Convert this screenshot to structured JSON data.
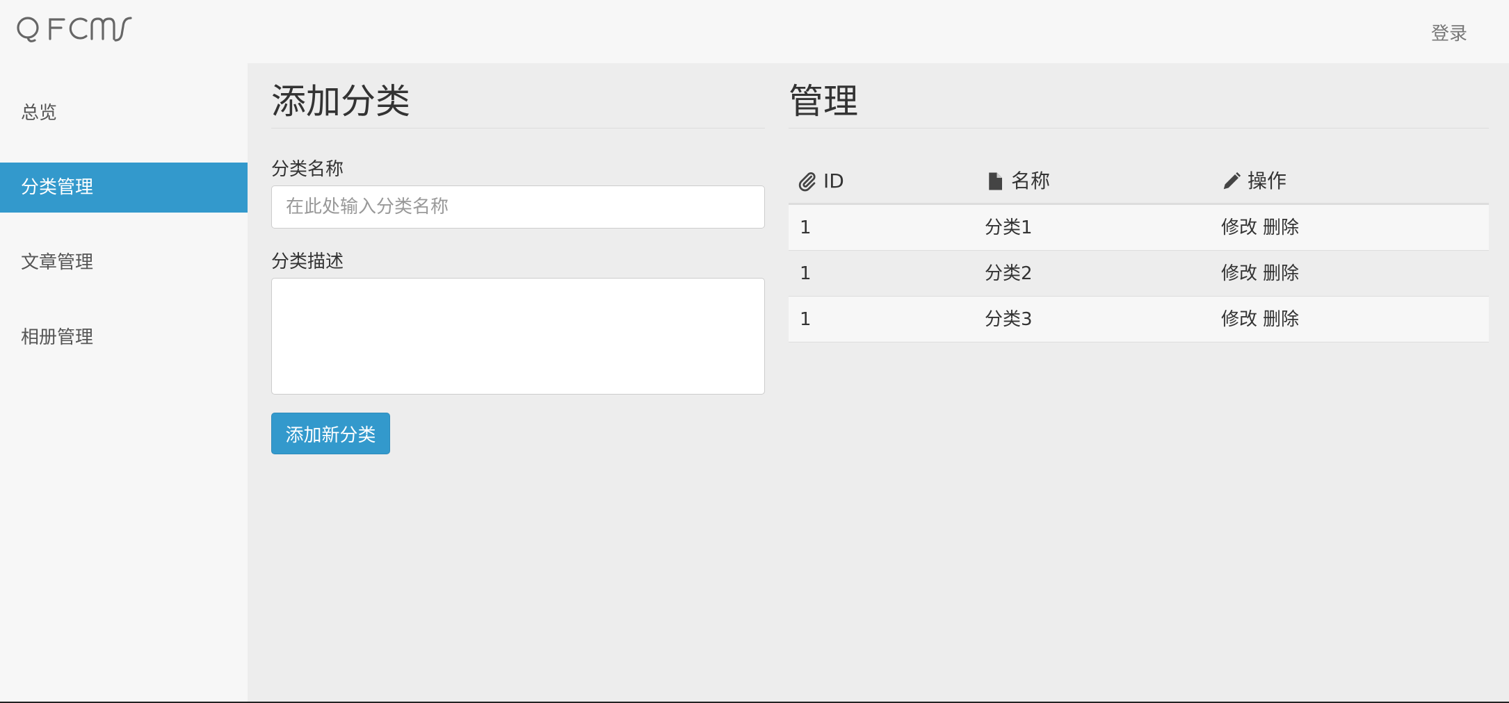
{
  "header": {
    "logo_text": "QFCMS",
    "login_label": "登录"
  },
  "sidebar": {
    "items": [
      {
        "label": "总览",
        "active": false
      },
      {
        "label": "分类管理",
        "active": true
      },
      {
        "label": "文章管理",
        "active": false
      },
      {
        "label": "相册管理",
        "active": false
      }
    ]
  },
  "form": {
    "title": "添加分类",
    "name_label": "分类名称",
    "name_placeholder": "在此处输入分类名称",
    "name_value": "",
    "desc_label": "分类描述",
    "desc_value": "",
    "submit_label": "添加新分类"
  },
  "manage": {
    "title": "管理",
    "columns": [
      {
        "label": "ID",
        "icon": "paperclip-icon"
      },
      {
        "label": "名称",
        "icon": "file-icon"
      },
      {
        "label": "操作",
        "icon": "pencil-icon"
      }
    ],
    "rows": [
      {
        "id": "1",
        "name": "分类1",
        "edit": "修改",
        "delete": "删除"
      },
      {
        "id": "1",
        "name": "分类2",
        "edit": "修改",
        "delete": "删除"
      },
      {
        "id": "1",
        "name": "分类3",
        "edit": "修改",
        "delete": "删除"
      }
    ]
  },
  "colors": {
    "accent": "#3399cc",
    "sidebar_bg": "#f7f7f7",
    "content_bg": "#ededed"
  }
}
